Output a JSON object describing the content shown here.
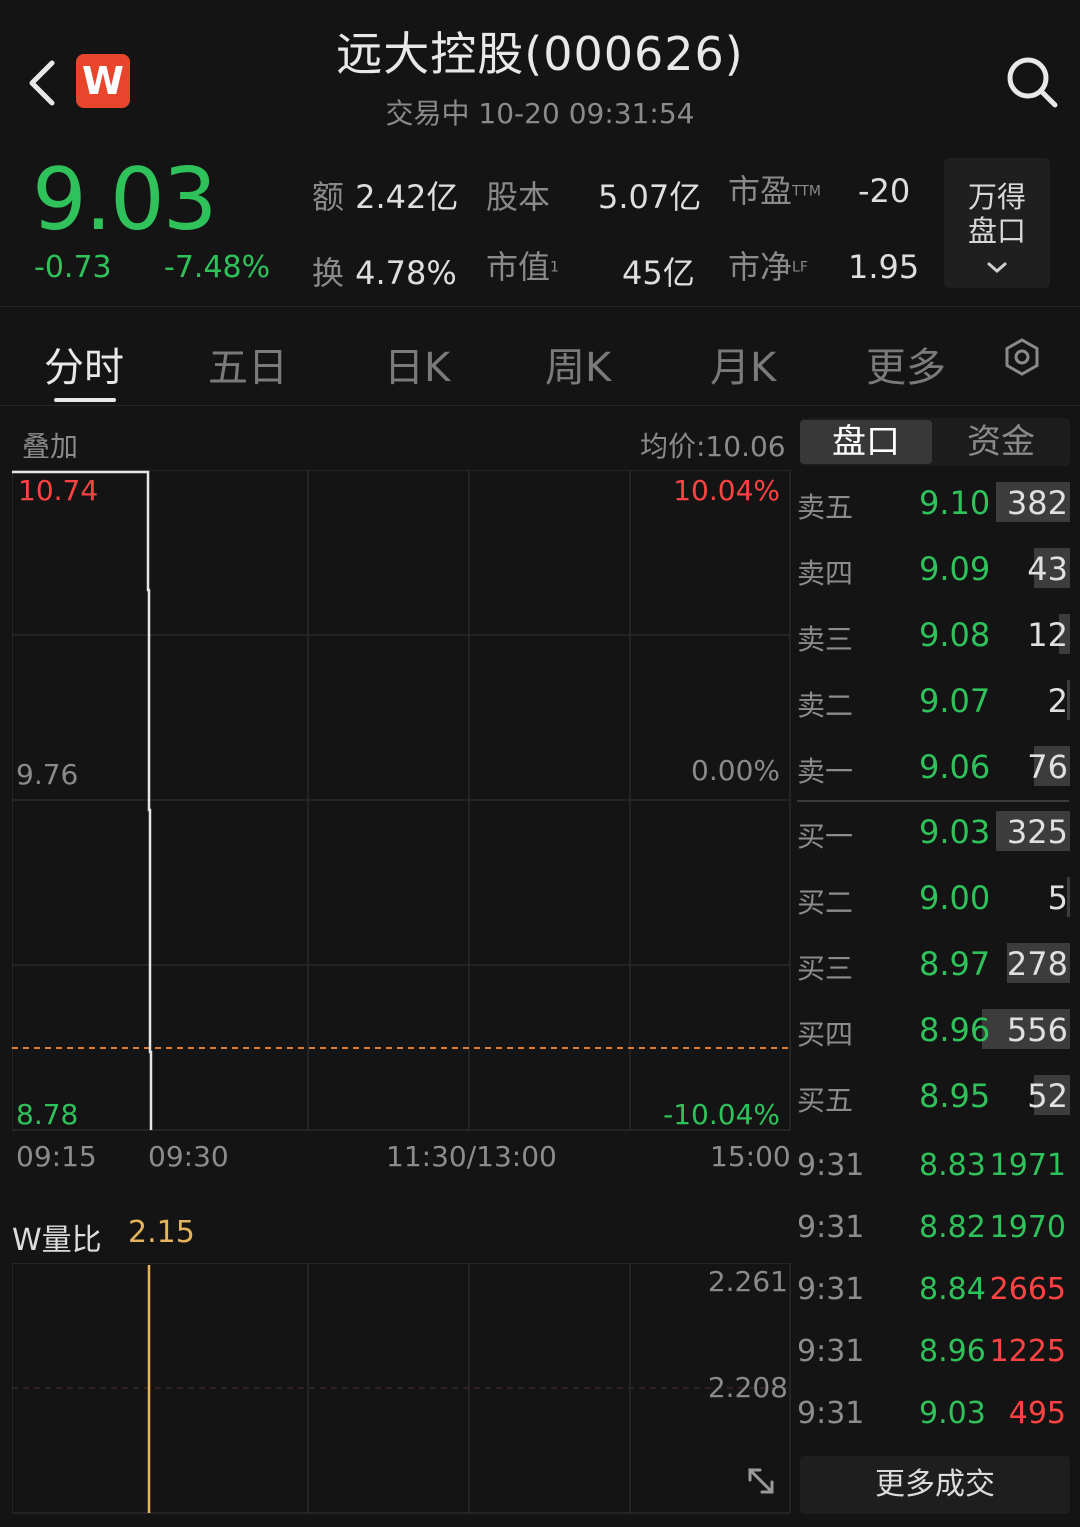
{
  "header": {
    "logo_text": "W",
    "title": "远大控股(000626)",
    "subtitle": "交易中  10-20 09:31:54"
  },
  "quote": {
    "price": "9.03",
    "change": "-0.73",
    "change_pct": "-7.48%",
    "stats": [
      {
        "label": "额",
        "value": "2.42亿"
      },
      {
        "label": "股本",
        "value": "5.07亿"
      },
      {
        "label": "市盈",
        "sup": "TTM",
        "value": "-20"
      },
      {
        "label": "换",
        "value": "4.78%"
      },
      {
        "label": "市值",
        "sup": "1",
        "value": "45亿"
      },
      {
        "label": "市净",
        "sup": "LF",
        "value": "1.95"
      }
    ],
    "wind_button": [
      "万得",
      "盘口"
    ]
  },
  "tabs": [
    "分时",
    "五日",
    "日K",
    "周K",
    "月K",
    "更多"
  ],
  "active_tab": 0,
  "chart": {
    "overlay_label": "叠加",
    "avg_price": "均价:10.06",
    "y_left": [
      "10.74",
      "9.76",
      "8.78"
    ],
    "y_right": [
      "10.04%",
      "0.00%",
      "-10.04%"
    ],
    "x_labels": [
      "09:15",
      "09:30",
      "11:30/13:00",
      "15:00"
    ]
  },
  "volume": {
    "label": "W量比",
    "value": "2.15",
    "y_labels": [
      "2.261",
      "2.208"
    ]
  },
  "orderbook": {
    "tabs": [
      "盘口",
      "资金"
    ],
    "asks": [
      {
        "label": "卖五",
        "price": "9.10",
        "vol": "382",
        "bar": 0.27
      },
      {
        "label": "卖四",
        "price": "9.09",
        "vol": "43",
        "bar": 0.13
      },
      {
        "label": "卖三",
        "price": "9.08",
        "vol": "12",
        "bar": 0.04
      },
      {
        "label": "卖二",
        "price": "9.07",
        "vol": "2",
        "bar": 0.01
      },
      {
        "label": "卖一",
        "price": "9.06",
        "vol": "76",
        "bar": 0.13
      }
    ],
    "bids": [
      {
        "label": "买一",
        "price": "9.03",
        "vol": "325",
        "bar": 0.27
      },
      {
        "label": "买二",
        "price": "9.00",
        "vol": "5",
        "bar": 0.01
      },
      {
        "label": "买三",
        "price": "8.97",
        "vol": "278",
        "bar": 0.23
      },
      {
        "label": "买四",
        "price": "8.96",
        "vol": "556",
        "bar": 0.32
      },
      {
        "label": "买五",
        "price": "8.95",
        "vol": "52",
        "bar": 0.13
      }
    ]
  },
  "trades": [
    {
      "time": "9:31",
      "price": "8.83",
      "vol": "1971",
      "color": "#2fc25b"
    },
    {
      "time": "9:31",
      "price": "8.82",
      "vol": "1970",
      "color": "#2fc25b"
    },
    {
      "time": "9:31",
      "price": "8.84",
      "vol": "2665",
      "color": "#ff4343"
    },
    {
      "time": "9:31",
      "price": "8.96",
      "vol": "1225",
      "color": "#ff4343"
    },
    {
      "time": "9:31",
      "price": "9.03",
      "vol": "495",
      "color": "#ff4343"
    }
  ],
  "more_trades": "更多成交",
  "colors": {
    "up": "#ff4343",
    "down": "#2fc25b",
    "volume_line": "#e4b35a",
    "prev_close": "#e07b2c"
  }
}
